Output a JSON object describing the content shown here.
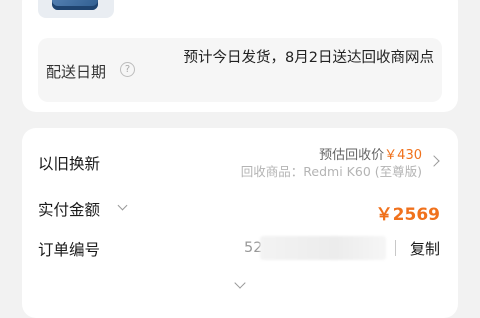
{
  "delivery": {
    "label": "配送日期",
    "help_icon": "?",
    "value": "预计今日发货，8月2日送达回收商网点"
  },
  "trade_in": {
    "label": "以旧换新",
    "estimate_label": "预估回收价",
    "estimate_price": "￥430",
    "item": "回收商品：Redmi K60 (至尊版)"
  },
  "payment": {
    "label": "实付金额",
    "amount": "￥2569"
  },
  "order": {
    "label": "订单编号",
    "number_visible": "52",
    "copy_label": "复制"
  },
  "colors": {
    "accent": "#f0711c",
    "background": "#f2f2f2",
    "card": "#ffffff"
  }
}
